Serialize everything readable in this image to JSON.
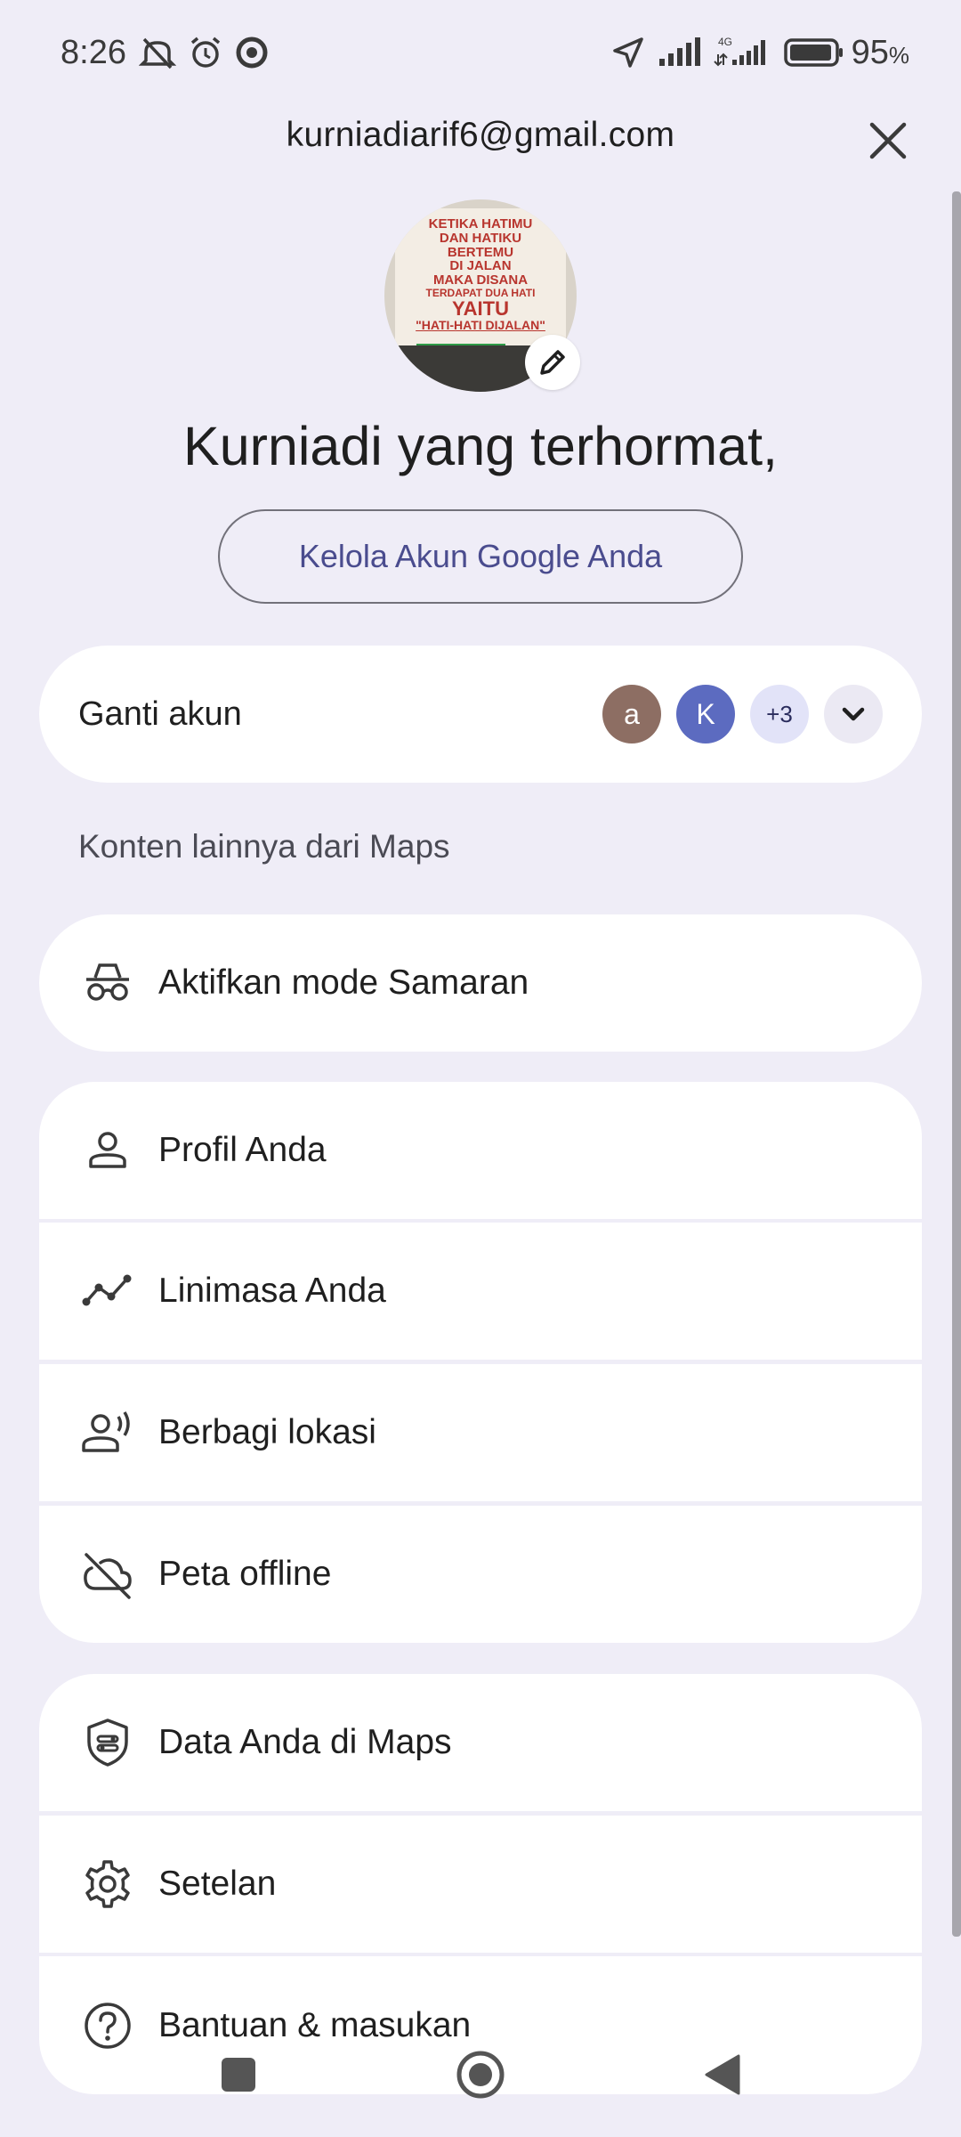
{
  "status_bar": {
    "time": "8:26",
    "network_label": "4G",
    "battery_percent": "95",
    "battery_suffix": "%"
  },
  "header": {
    "email": "kurniadiarif6@gmail.com",
    "greeting": "Kurniadi yang terhormat,",
    "manage_button": "Kelola Akun Google Anda"
  },
  "avatar_sign": {
    "lines": [
      "KETIKA HATIMU",
      "DAN HATIKU",
      "BERTEMU",
      "DI JALAN",
      "MAKA DISANA",
      "TERDAPAT DUA HATI",
      "YAITU",
      "\"HATI-HATI DIJALAN\""
    ]
  },
  "switch_account": {
    "label": "Ganti akun",
    "accounts": [
      "a",
      "K"
    ],
    "more": "+3"
  },
  "section": {
    "title": "Konten lainnya dari Maps"
  },
  "menu": {
    "incognito": "Aktifkan mode Samaran",
    "profile": "Profil Anda",
    "timeline": "Linimasa Anda",
    "location_sharing": "Berbagi lokasi",
    "offline_maps": "Peta offline",
    "your_data": "Data Anda di Maps",
    "settings": "Setelan",
    "help": "Bantuan & masukan"
  },
  "colors": {
    "background": "#efedf7",
    "accent_text": "#4a4c8e",
    "avatar_a": "#8d6e63",
    "avatar_k": "#5c6bc0"
  }
}
